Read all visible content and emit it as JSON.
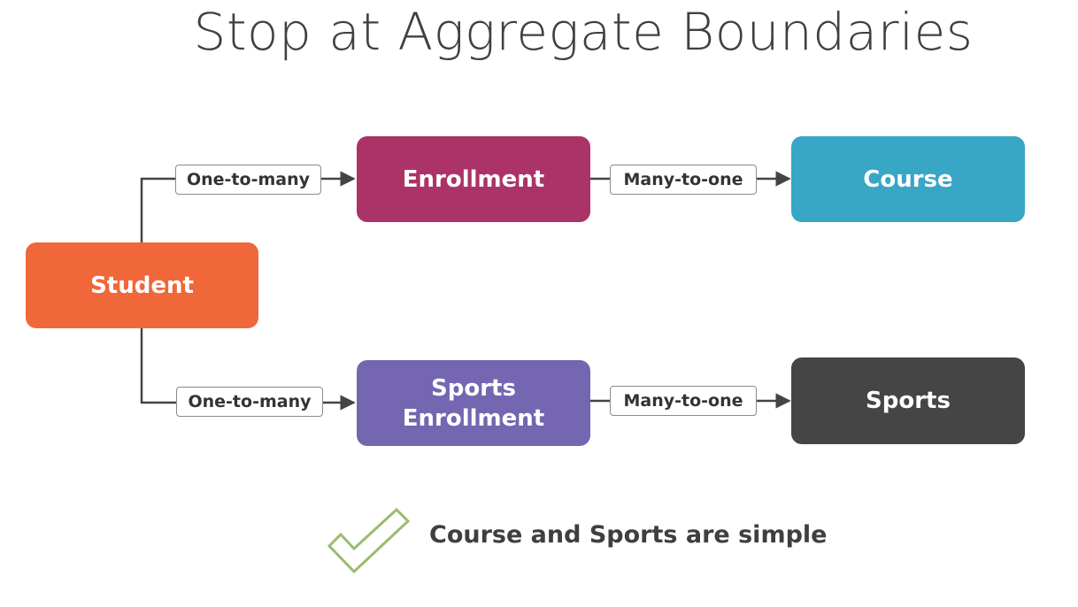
{
  "title": "Stop at Aggregate Boundaries",
  "nodes": {
    "student": {
      "label": "Student",
      "color": "#f0673a"
    },
    "enrollment": {
      "label": "Enrollment",
      "color": "#ab3367"
    },
    "course": {
      "label": "Course",
      "color": "#38a6c5"
    },
    "sports_enrollment": {
      "line1": "Sports",
      "line2": "Enrollment",
      "color": "#7466b0"
    },
    "sports": {
      "label": "Sports",
      "color": "#454545"
    }
  },
  "relations": {
    "student_to_enrollment": "One-to-many",
    "enrollment_to_course": "Many-to-one",
    "student_to_sports_enrollment": "One-to-many",
    "sports_enrollment_to_sports": "Many-to-one"
  },
  "footer": {
    "icon": "checkmark-icon",
    "icon_color": "#9bbb6f",
    "text": "Course and Sports are simple"
  }
}
